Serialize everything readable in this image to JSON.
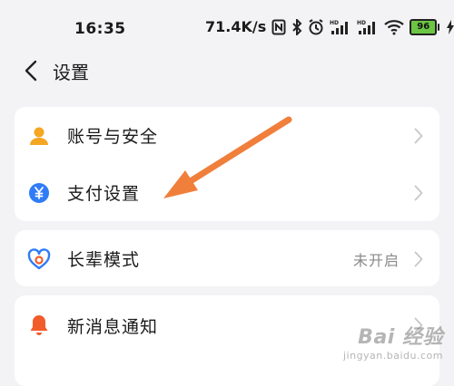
{
  "status_bar": {
    "time": "16:35",
    "net_speed": "71.4K/s",
    "battery": "96",
    "icons": [
      "nfc-icon",
      "bluetooth-icon",
      "alarm-icon",
      "hd-signal-icon",
      "hd-signal-icon",
      "wifi-icon",
      "battery-icon",
      "charging-icon"
    ]
  },
  "header": {
    "title": "设置",
    "back_icon": "chevron-left-icon"
  },
  "settings": {
    "group1": [
      {
        "label": "账号与安全",
        "icon": "user-icon",
        "icon_color": "#f5a623"
      },
      {
        "label": "支付设置",
        "icon": "yuan-icon",
        "icon_color": "#2f7cf6"
      }
    ],
    "group2": [
      {
        "label": "长辈模式",
        "value": "未开启",
        "icon": "heart-hands-icon",
        "icon_color": "#2f7cf6"
      }
    ],
    "group3": [
      {
        "label": "新消息通知",
        "icon": "bell-icon",
        "icon_color": "#f25c2a"
      }
    ]
  },
  "annotation": {
    "arrow_color": "#f07f3c"
  },
  "watermark": {
    "main": "Bai 经验",
    "sub": "jingyan.baidu.com"
  }
}
